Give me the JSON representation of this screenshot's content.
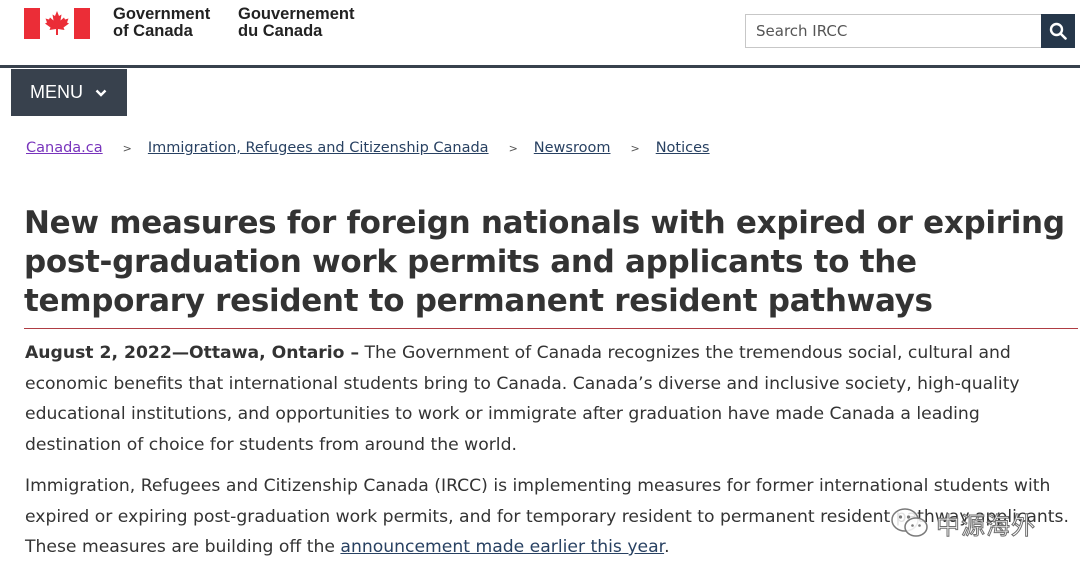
{
  "header": {
    "signature_en_line1": "Government",
    "signature_en_line2": "of Canada",
    "signature_fr_line1": "Gouvernement",
    "signature_fr_line2": "du Canada",
    "flag_icon": "canada-flag-icon",
    "flag_color": "#eb2d37"
  },
  "search": {
    "placeholder": "Search IRCC",
    "button_icon": "search-icon"
  },
  "menu": {
    "label": "MENU",
    "icon": "chevron-down-icon"
  },
  "breadcrumb": [
    {
      "label": "Canada.ca"
    },
    {
      "label": "Immigration, Refugees and Citizenship Canada"
    },
    {
      "label": "Newsroom"
    },
    {
      "label": "Notices"
    }
  ],
  "breadcrumb_separator": ">",
  "article": {
    "title": "New measures for foreign nationals with expired or expiring post-graduation work permits and applicants to the temporary resident to permanent resident pathways",
    "dateline": "August 2, 2022—Ottawa, Ontario –",
    "p1_text": " The Government of Canada recognizes the tremendous social, cultural and economic benefits that international students bring to Canada. Canada’s diverse and inclusive society, high-quality educational institutions, and opportunities to work or immigrate after graduation have made Canada a leading destination of choice for students from around the world.",
    "p2_before": "Immigration, Refugees and Citizenship Canada (IRCC) is implementing measures for former international students with expired or expiring post-graduation work permits, and for temporary resident to permanent resident pathway applicants. These measures are building off the ",
    "p2_link": "announcement made earlier this year",
    "p2_after": "."
  },
  "watermark": {
    "text": "中源海外",
    "icon": "wechat-icon"
  },
  "colors": {
    "menu_bg": "#38414d",
    "search_button_bg": "#26374a",
    "link": "#284162",
    "visited_link": "#7834bc",
    "title_rule": "#af3c43"
  }
}
